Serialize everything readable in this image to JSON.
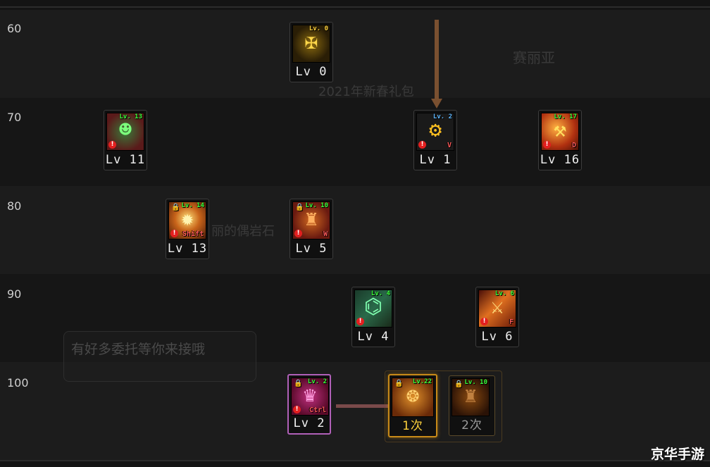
{
  "level_rows": [
    {
      "label": "60"
    },
    {
      "label": "70"
    },
    {
      "label": "80"
    },
    {
      "label": "90"
    },
    {
      "label": "100"
    }
  ],
  "background_text": {
    "top_right": "赛丽亚",
    "banner": "2021年新春礼包",
    "mid": "丽的偶岩石",
    "bubble": "有好多委托等你来接哦"
  },
  "skills": {
    "s60_a": {
      "tag": "Lv. 0",
      "level": "Lv 0",
      "icon": "golden-cross-icon"
    },
    "s70_a": {
      "tag": "Lv. 13",
      "level": "Lv 11",
      "icon": "green-robot-icon"
    },
    "s70_b": {
      "tag": "Lv. 2",
      "level": "Lv 1",
      "icon": "gear-icon",
      "key": "V"
    },
    "s70_c": {
      "tag": "Lv. 17",
      "level": "Lv 16",
      "icon": "flame-hammer-icon",
      "key": "D"
    },
    "s80_a": {
      "tag": "Lv. 14",
      "level": "Lv 13",
      "icon": "burst-icon",
      "key": "Shift"
    },
    "s80_b": {
      "tag": "Lv. 10",
      "level": "Lv 5",
      "icon": "armor-icon",
      "key": "W"
    },
    "s90_a": {
      "tag": "Lv. 4",
      "level": "Lv 4",
      "icon": "circuit-icon"
    },
    "s90_b": {
      "tag": "Lv. 6",
      "level": "Lv 6",
      "icon": "blade-icon",
      "key": "F"
    },
    "s100_a": {
      "tag": "Lv. 2",
      "level": "Lv 2",
      "icon": "pink-mech-icon",
      "key": "Ctrl"
    },
    "s100_b": {
      "tag": "Lv.22",
      "level": "1次",
      "icon": "orange-core-icon"
    },
    "s100_c": {
      "tag": "Lv. 10",
      "level": "2次",
      "icon": "dark-armor-icon"
    }
  },
  "watermark": "京华手游",
  "colors": {
    "accent_orange": "#c88a18",
    "accent_pink": "#b060b8",
    "tag_green": "#3cff3c",
    "connector_brown": "#7a5030"
  }
}
